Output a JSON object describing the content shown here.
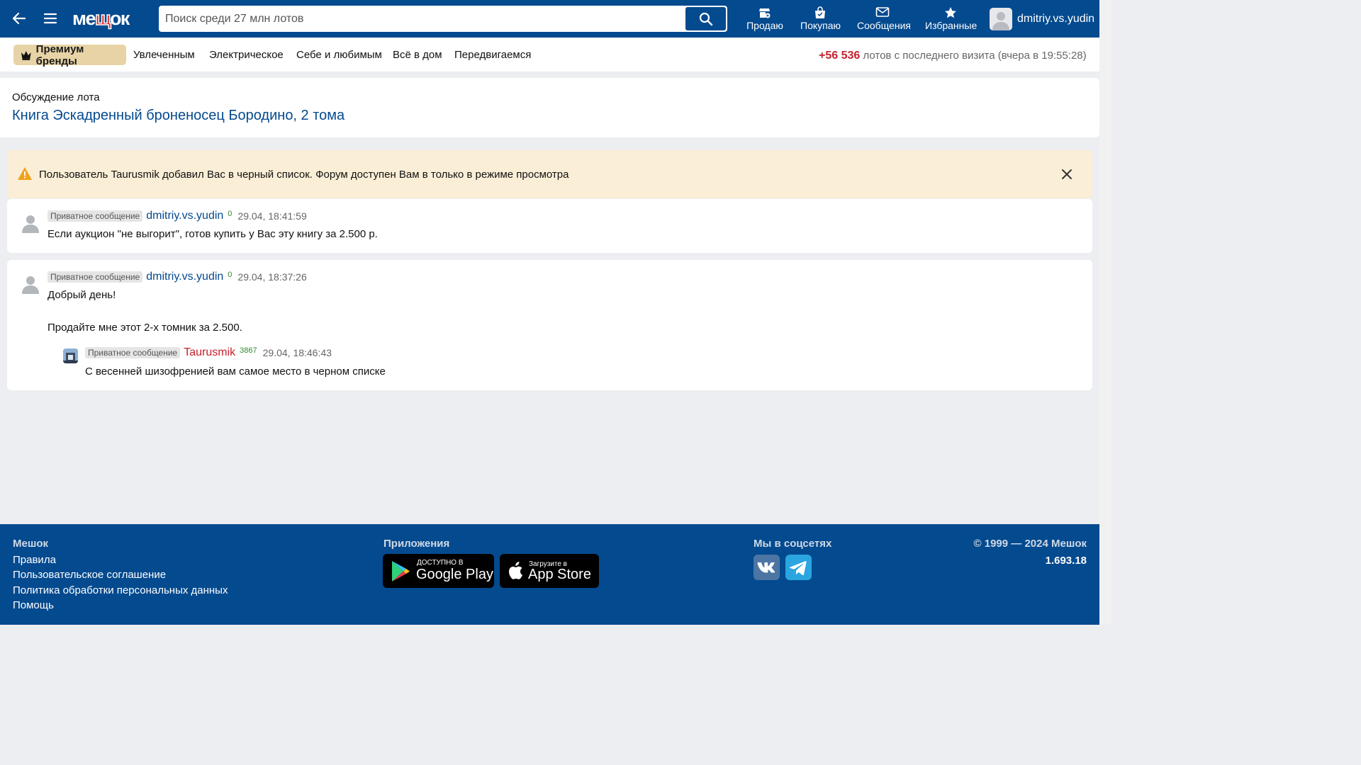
{
  "header": {
    "logo_text_1": "ме",
    "logo_text_2": "щ",
    "logo_text_3": "ок",
    "search_placeholder": "Поиск среди 27 млн лотов",
    "nav": [
      {
        "label": "Продаю",
        "icon": "sell-icon"
      },
      {
        "label": "Покупаю",
        "icon": "shopping-bag-icon"
      },
      {
        "label": "Сообщения",
        "icon": "mail-icon"
      },
      {
        "label": "Избранные",
        "icon": "star-icon"
      }
    ],
    "username": "dmitriy.vs.yudin"
  },
  "categories": {
    "premium": "Премиум бренды",
    "items": [
      "Увлеченным",
      "Электрическое",
      "Себе и любимым",
      "Всё в дом",
      "Передвигаемся"
    ],
    "lots_count": "+56 536",
    "lots_text": "лотов с последнего визита (вчера в 19:55:28)"
  },
  "lot": {
    "label": "Обсуждение лота",
    "title": "Книга Эскадренный броненосец Бородино, 2 тома"
  },
  "warning": {
    "text": "Пользователь Taurusmik добавил Вас в черный список. Форум доступен Вам в только в режиме просмотра"
  },
  "messages": [
    {
      "badge": "Приватное сообщение",
      "user": "dmitriy.vs.yudin",
      "rating": "0",
      "time": "29.04, 18:41:59",
      "text": "Если аукцион \"не выгорит\", готов купить у Вас эту книгу за 2.500 р."
    },
    {
      "badge": "Приватное сообщение",
      "user": "dmitriy.vs.yudin",
      "rating": "0",
      "time": "29.04, 18:37:26",
      "text_line1": "Добрый день!",
      "text_line2": "Продайте мне этот 2-х томник за 2.500.",
      "reply": {
        "badge": "Приватное сообщение",
        "user": "Taurusmik",
        "rating": "3867",
        "time": "29.04, 18:46:43",
        "text": "С весенней шизофренией вам самое место в черном списке"
      }
    }
  ],
  "footer": {
    "col1_title": "Мешок",
    "links": [
      "Правила",
      "Пользовательское соглашение",
      "Политика обработки персональных данных",
      "Помощь"
    ],
    "apps_title": "Приложения",
    "google_small": "ДОСТУПНО В",
    "google_big": "Google Play",
    "apple_small": "Загрузите в",
    "apple_big": "App Store",
    "social_title": "Мы в соцсетях",
    "copyright": "© 1999 — 2024 Мешок",
    "version": "1.693.18"
  },
  "colors": {
    "brand_blue": "#044a8f",
    "accent_red": "#c6202b",
    "warning_bg": "#fbeed6",
    "premium_bg": "#e7d3a5"
  }
}
